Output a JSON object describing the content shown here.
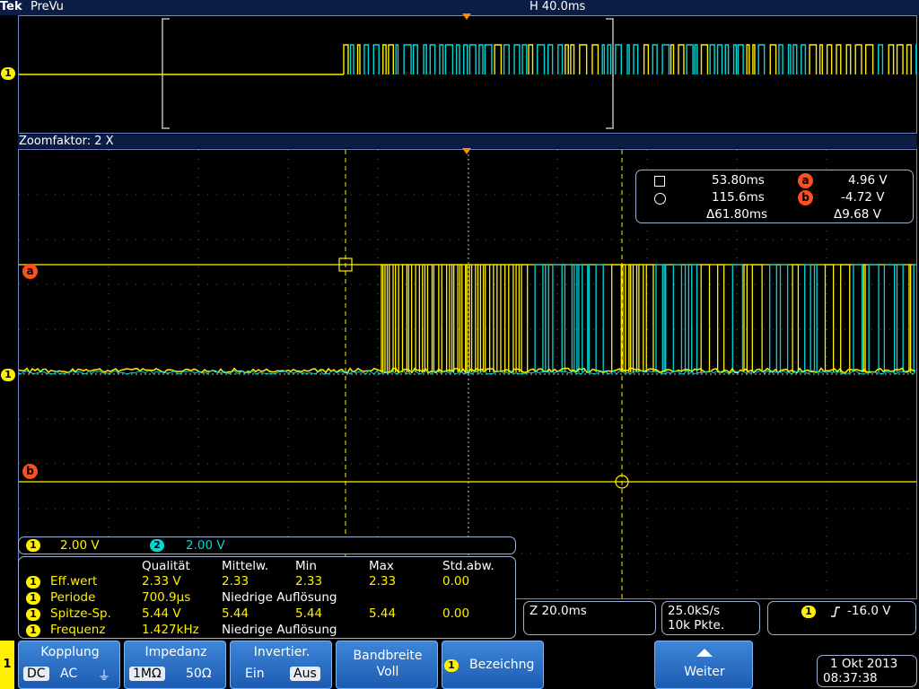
{
  "header": {
    "brand": "Tek",
    "mode": "PreVu",
    "horizontal_scale": "H 40.0ms"
  },
  "zoom": {
    "label": "Zoomfaktor: 2 X"
  },
  "channel_markers": {
    "ch1": "1",
    "cursor_a": "a",
    "cursor_b": "b"
  },
  "cursor_readout": {
    "c1_time": "53.80ms",
    "c2_time": "115.6ms",
    "delta_time": "Δ61.80ms",
    "a_marker": "a",
    "a_value": "4.96 V",
    "b_marker": "b",
    "b_value": "-4.72 V",
    "delta_volt": "Δ9.68 V"
  },
  "channel_scales": [
    {
      "ch": "1",
      "value": "2.00 V"
    },
    {
      "ch": "2",
      "value": "2.00 V"
    }
  ],
  "measurements": {
    "headers": [
      "Qualität",
      "Mittelw.",
      "Min",
      "Max",
      "Std.abw."
    ],
    "rows": [
      {
        "ch": "1",
        "name": "Eff.wert",
        "cols": [
          "2.33 V",
          "2.33",
          "2.33",
          "2.33",
          "0.00"
        ]
      },
      {
        "ch": "1",
        "name": "Periode",
        "cols": [
          "700.9µs",
          "Niedrige Auflösung"
        ]
      },
      {
        "ch": "1",
        "name": "Spitze-Sp.",
        "cols": [
          "5.44 V",
          "5.44",
          "5.44",
          "5.44",
          "0.00"
        ]
      },
      {
        "ch": "1",
        "name": "Frequenz",
        "cols": [
          "1.427kHz",
          "Niedrige Auflösung"
        ]
      }
    ]
  },
  "status": {
    "zoom_scale": "Z 20.0ms",
    "sample_rate": "25.0kS/s",
    "record_length": "10k Pkte.",
    "trigger_ch": "1",
    "trigger_level": "-16.0 V"
  },
  "menu": {
    "side_ch": "1",
    "kopplung": {
      "label": "Kopplung",
      "dc": "DC",
      "ac": "AC",
      "gnd": "⏚"
    },
    "impedanz": {
      "label": "Impedanz",
      "opt1": "1MΩ",
      "opt2": "50Ω"
    },
    "invertier": {
      "label": "Invertier.",
      "opt1": "Ein",
      "opt2": "Aus"
    },
    "bandbreite": {
      "label": "Bandbreite",
      "value": "Voll"
    },
    "bezeichnung": {
      "ch": "1",
      "label": "Bezeichng"
    },
    "weiter": {
      "label": "Weiter"
    }
  },
  "datetime": {
    "date": "1 Okt  2013",
    "time": "08:37:38"
  },
  "colors": {
    "ch1": "#ffef00",
    "ch2": "#00d8d8",
    "cursor": "#ff4e1e",
    "frame": "#6f89c2"
  }
}
